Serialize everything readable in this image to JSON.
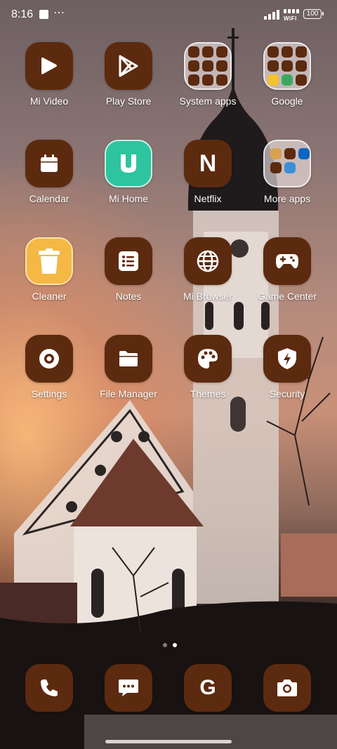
{
  "status_bar": {
    "time": "8:16",
    "notif": "⋯",
    "wifi_label": "WIFI",
    "battery": "100"
  },
  "icons": {
    "mi_video": "play-triangle-icon",
    "play_store": "play-store-icon",
    "calendar": "calendar-icon",
    "mi_home": "mi-home-icon",
    "netflix": "netflix-n-icon",
    "cleaner": "trash-bin-icon",
    "notes": "notes-list-icon",
    "mi_browser": "globe-icon",
    "game_center": "gamepad-icon",
    "settings": "gear-icon",
    "file_manager": "folder-icon",
    "themes": "palette-icon",
    "security": "shield-bolt-icon",
    "phone": "phone-icon",
    "messages": "chat-bubble-icon",
    "google": "google-g-icon",
    "camera": "camera-icon"
  },
  "apps": [
    {
      "label": "Mi Video"
    },
    {
      "label": "Play Store"
    },
    {
      "label": "System apps"
    },
    {
      "label": "Google"
    },
    {
      "label": "Calendar"
    },
    {
      "label": "Mi Home"
    },
    {
      "label": "Netflix"
    },
    {
      "label": "More apps"
    },
    {
      "label": "Cleaner"
    },
    {
      "label": "Notes"
    },
    {
      "label": "Mi Browser"
    },
    {
      "label": "Game Center"
    },
    {
      "label": "Settings"
    },
    {
      "label": "File Manager"
    },
    {
      "label": "Themes"
    },
    {
      "label": "Security"
    }
  ],
  "netflix_glyph": "N",
  "google_glyph": "G",
  "pager": {
    "pages": 2,
    "current": 2
  },
  "colors": {
    "icon_bg": "#5c2a0f",
    "mi_home": "#2ec4a0",
    "cleaner": "#f5b844"
  }
}
